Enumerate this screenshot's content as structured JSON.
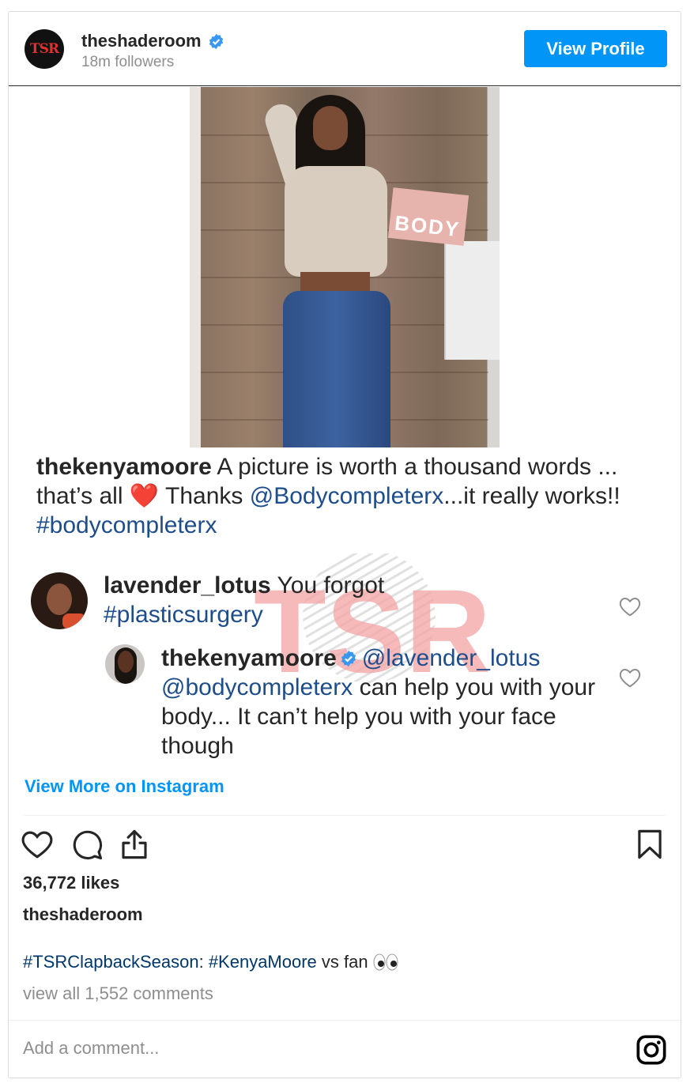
{
  "header": {
    "username": "theshaderoom",
    "followers": "18m followers",
    "view_profile_label": "View Profile",
    "avatar_logo_text": "TSR"
  },
  "media": {
    "box_text": "BODY",
    "watermark_text": "TSR",
    "caption": {
      "author": "thekenyamoore",
      "text_1": " A picture is worth a thousand words ... that’s all ",
      "emoji": "❤️",
      "text_2": " Thanks ",
      "mention": "@Bodycompleterx",
      "text_3": "...it really works!! ",
      "hashtag": "#bodycompleterx"
    },
    "comment_1": {
      "author": "lavender_lotus",
      "text": " You forgot ",
      "hashtag": "#plasticsurgery"
    },
    "comment_2": {
      "author": "thekenyamoore",
      "mention_1": "@lavender_lotus",
      "mention_2": "@bodycompleterx",
      "text": " can help you with your body... It can’t help you with your face though"
    }
  },
  "view_more_label": "View More on Instagram",
  "likes": "36,772 likes",
  "owner": "theshaderoom",
  "post_caption": {
    "tag_1": "#TSRClapbackSeason",
    "sep": ": ",
    "tag_2": "#KenyaMoore",
    "text": " vs fan"
  },
  "view_all_comments": "view all 1,552 comments",
  "add_comment_placeholder": "Add a comment...",
  "colors": {
    "accent": "#0095f6",
    "verified": "#3897f0",
    "link": "#00376b",
    "watermark": "#f4a9a9"
  },
  "icons": [
    "verified-badge-icon",
    "heart-icon",
    "comment-icon",
    "share-icon",
    "bookmark-icon",
    "instagram-icon",
    "eyes-emoji-icon"
  ]
}
